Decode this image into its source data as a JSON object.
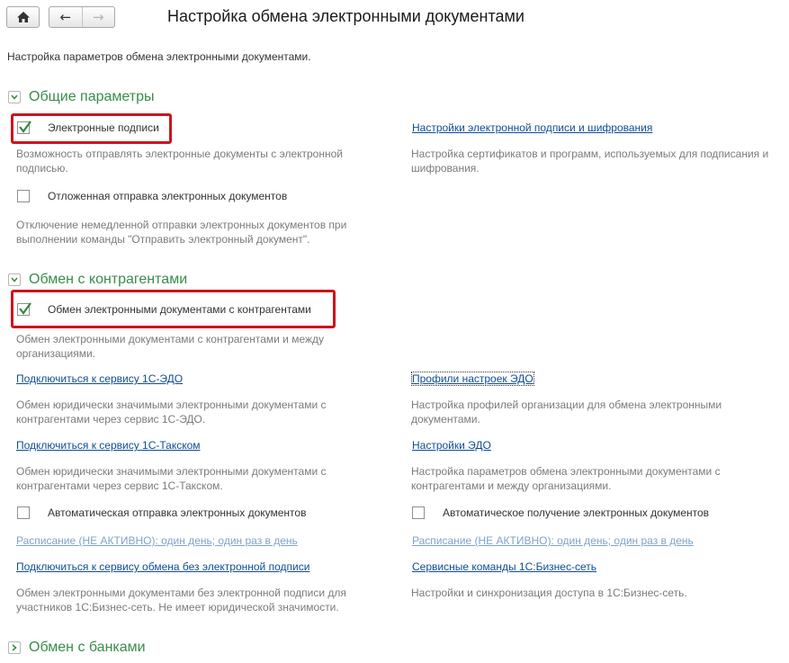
{
  "window": {
    "title": "Настройка обмена электронными документами",
    "subtitle": "Настройка параметров обмена электронными документами."
  },
  "toolbar": {
    "home_icon": "home-icon",
    "back_icon": "arrow-left-icon",
    "forward_icon": "arrow-right-icon"
  },
  "sections": {
    "general": {
      "title": "Общие параметры",
      "expanded": true,
      "esign_checkbox": {
        "label": "Электронные подписи",
        "checked": true
      },
      "esign_desc": "Возможность отправлять электронные документы с электронной подписью.",
      "esign_settings_link": "Настройки электронной подписи и шифрования",
      "esign_settings_desc": "Настройка сертификатов и программ, используемых для подписания и шифрования.",
      "deferred_checkbox": {
        "label": "Отложенная отправка электронных документов",
        "checked": false
      },
      "deferred_desc": "Отключение немедленной отправки электронных документов при выполнении команды \"Отправить электронный документ\"."
    },
    "counterparties": {
      "title": "Обмен с контрагентами",
      "expanded": true,
      "exchange_checkbox": {
        "label": "Обмен электронными документами с контрагентами",
        "checked": true
      },
      "exchange_desc": "Обмен электронными документами с контрагентами и между организациями.",
      "edo_link": "Подключиться к сервису 1С-ЭДО",
      "edo_desc": "Обмен юридически значимыми электронными документами с контрагентами через сервис 1С-ЭДО.",
      "profiles_link": "Профили настроек ЭДО",
      "profiles_desc": "Настройка профилей организации для обмена электронными документами.",
      "taxcom_link": "Подключиться к сервису 1С-Такском",
      "taxcom_desc": "Обмен юридически значимыми электронными документами с контрагентами через сервис 1С-Такском.",
      "edo_settings_link": "Настройки ЭДО",
      "edo_settings_desc": "Настройка параметров обмена электронными документами с контрагентами и между организациями.",
      "auto_send_checkbox": {
        "label": "Автоматическая отправка электронных документов",
        "checked": false
      },
      "auto_receive_checkbox": {
        "label": "Автоматическое получение электронных документов",
        "checked": false
      },
      "send_schedule_link": "Расписание (НЕ АКТИВНО): один день; один раз в день",
      "receive_schedule_link": "Расписание (НЕ АКТИВНО): один день; один раз в день",
      "no_sign_link": "Подключиться к сервису обмена без электронной подписи",
      "no_sign_desc": "Обмен электронными документами без электронной подписи для участников 1С:Бизнес-сеть. Не имеет юридической значимости.",
      "service_commands_link": "Сервисные команды 1С:Бизнес-сеть",
      "service_commands_desc": "Настройки и синхронизация доступа в 1С:Бизнес-сеть."
    },
    "banks": {
      "title": "Обмен с банками",
      "expanded": false
    }
  },
  "colors": {
    "section_title": "#3a8c4a",
    "link": "#0f4c96",
    "inactive_link": "#7fa3cc",
    "highlight_frame": "#d0121b",
    "check_mark": "#2e8b3e"
  }
}
